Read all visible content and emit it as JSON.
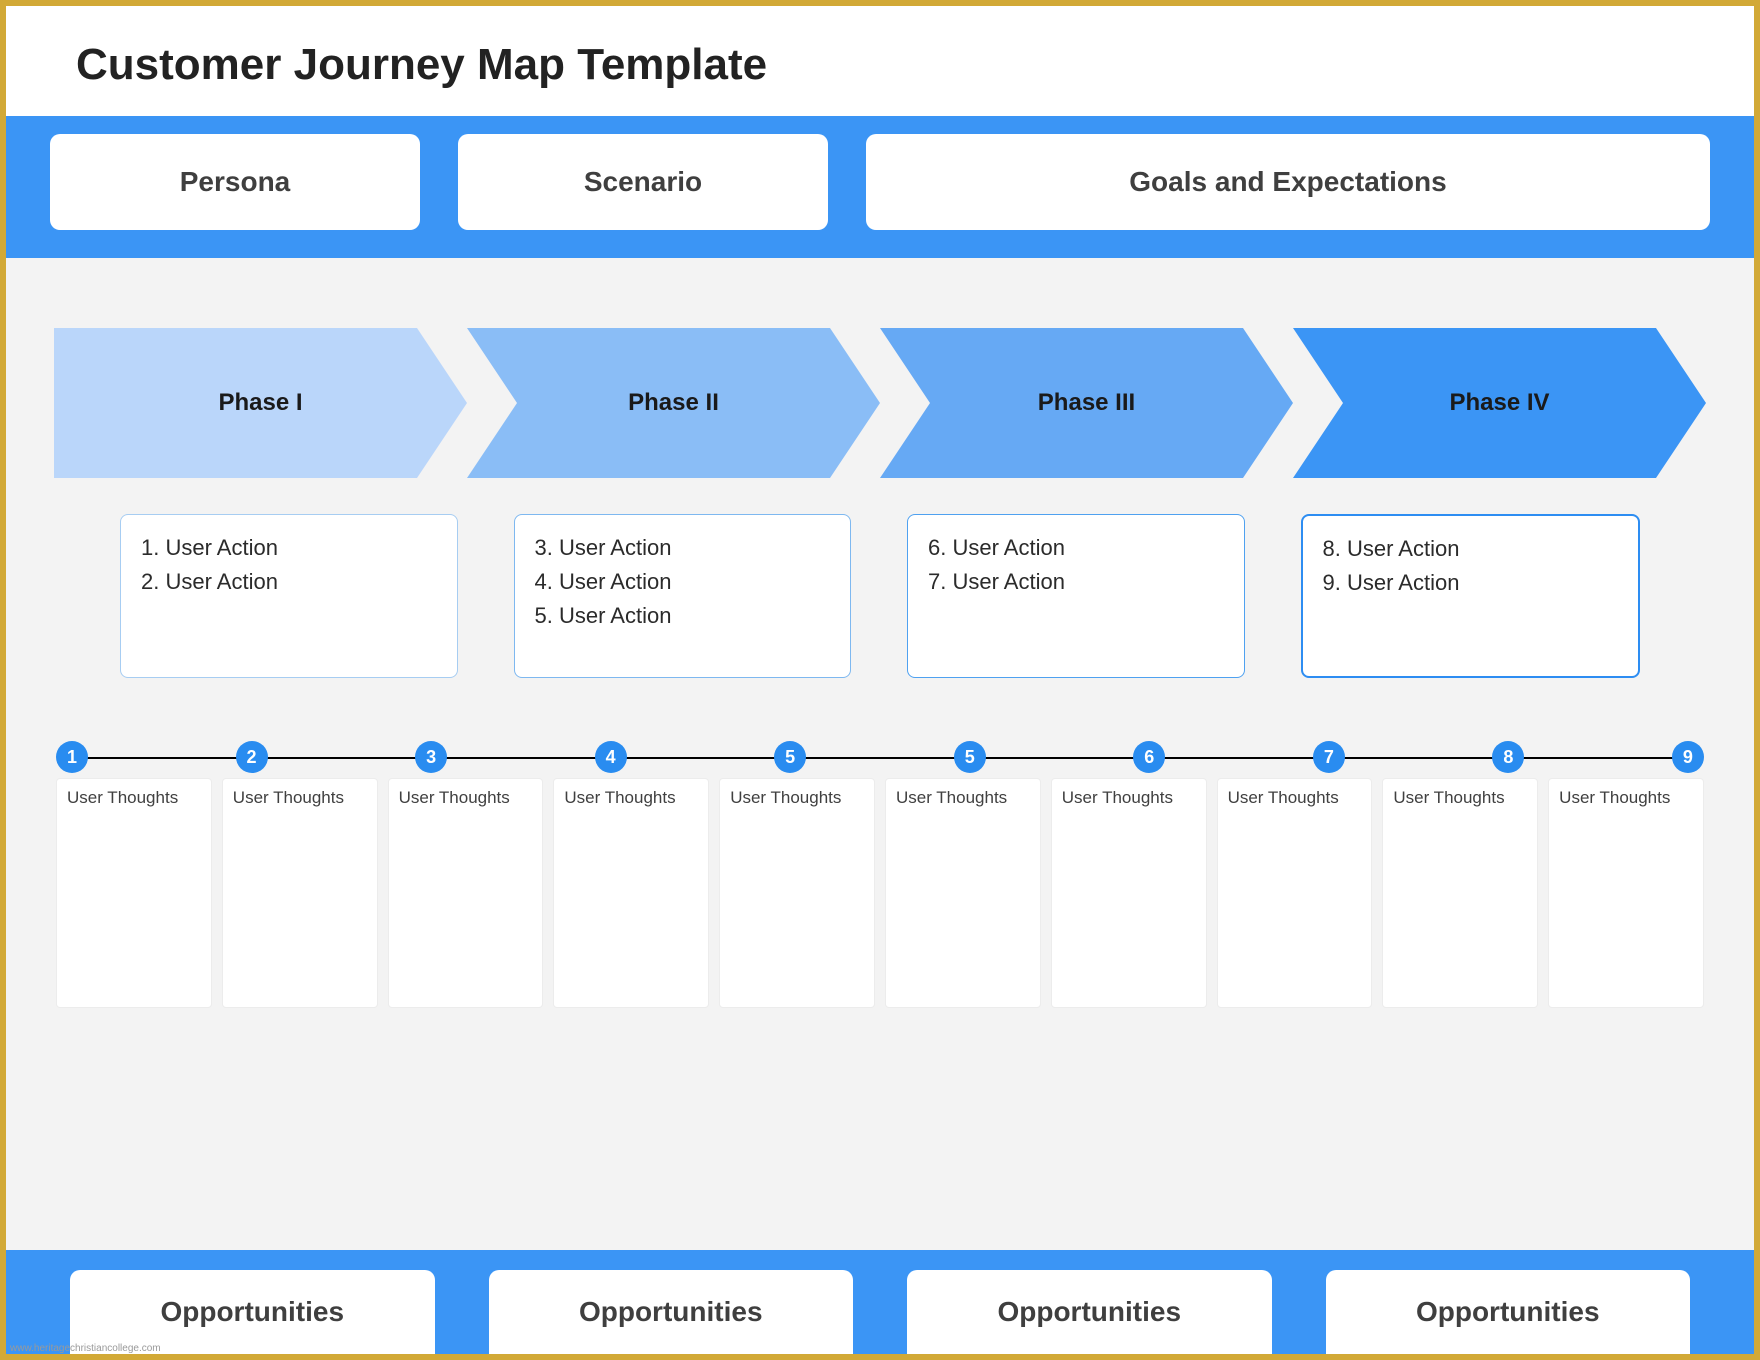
{
  "title": "Customer Journey Map Template",
  "header": {
    "persona": "Persona",
    "scenario": "Scenario",
    "goals": "Goals and Expectations"
  },
  "phases": [
    {
      "label": "Phase I"
    },
    {
      "label": "Phase II"
    },
    {
      "label": "Phase III"
    },
    {
      "label": "Phase IV"
    }
  ],
  "actions": [
    {
      "items": [
        "1. User Action",
        "2. User Action"
      ]
    },
    {
      "items": [
        "3. User Action",
        "4. User Action",
        "5. User Action"
      ]
    },
    {
      "items": [
        "6. User Action",
        "7. User Action"
      ]
    },
    {
      "items": [
        "8. User Action",
        "9. User Action"
      ]
    }
  ],
  "timeline": {
    "points": [
      "1",
      "2",
      "3",
      "4",
      "5",
      "5",
      "6",
      "7",
      "8",
      "9"
    ],
    "thought_label": "User Thoughts"
  },
  "footer": {
    "label": "Opportunities",
    "count": 4
  },
  "watermark": "www.heritagechristiancollege.com"
}
